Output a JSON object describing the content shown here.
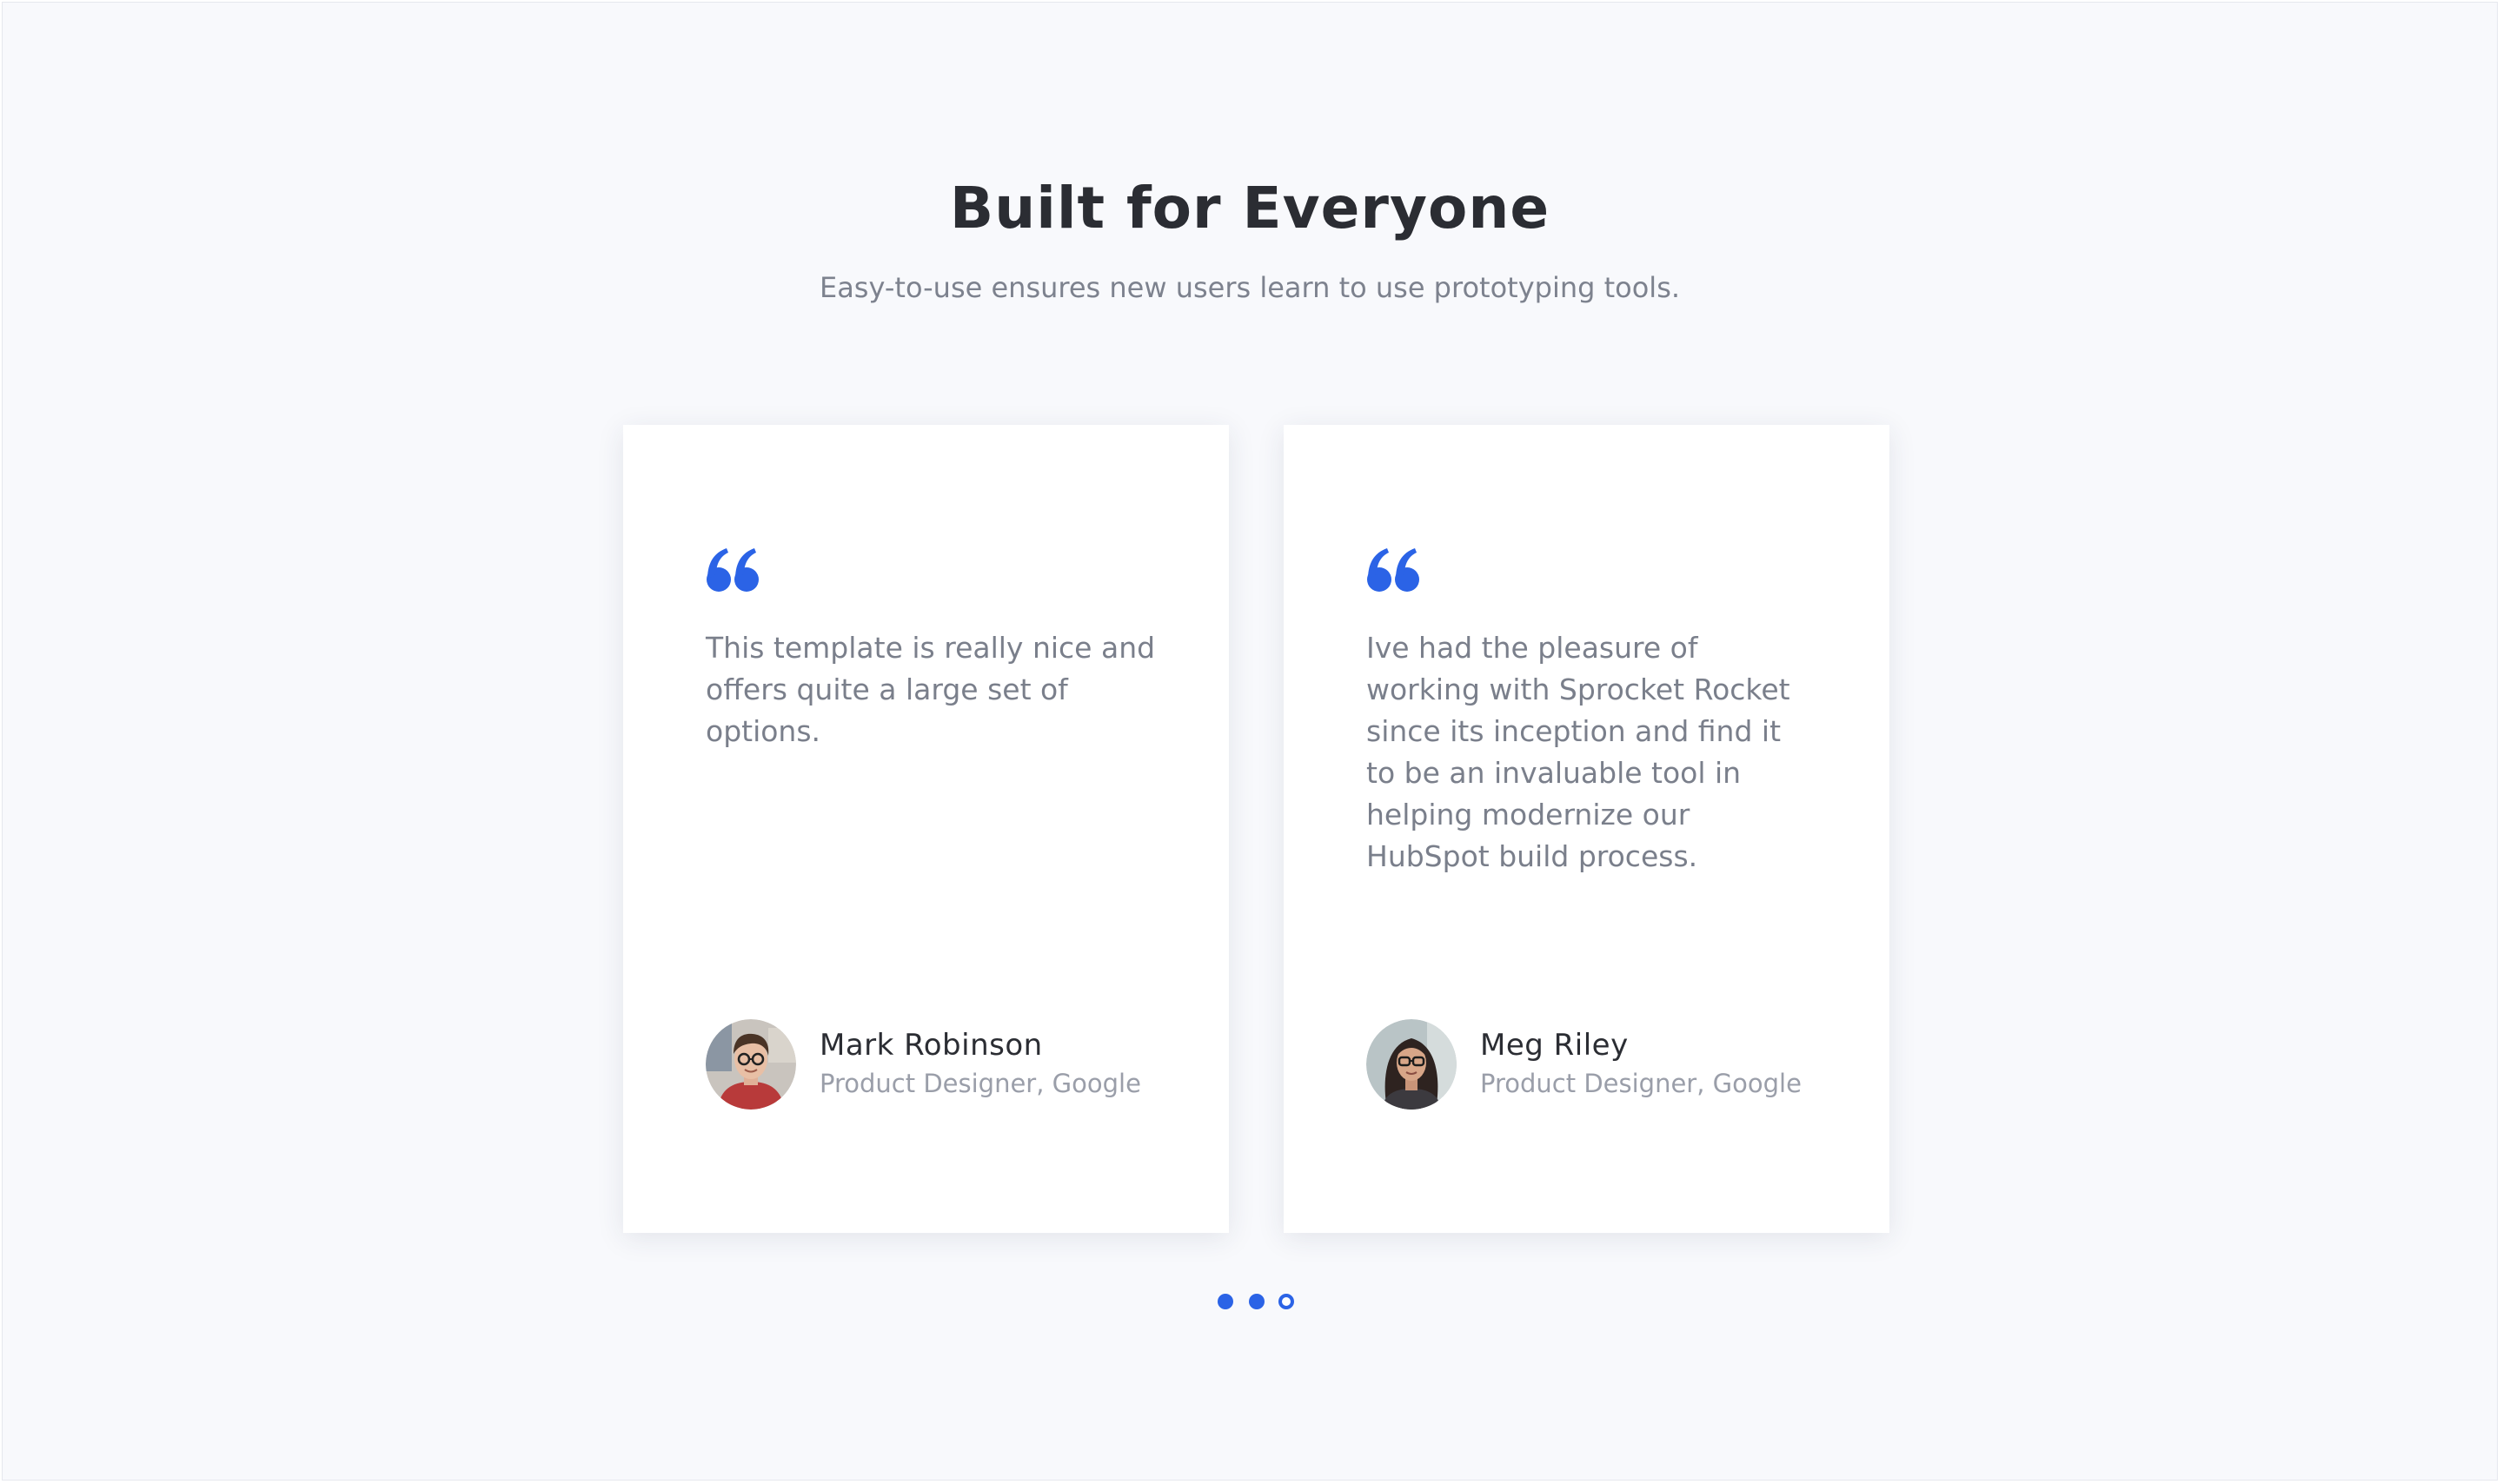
{
  "section": {
    "title": "Built for Everyone",
    "subtitle": "Easy-to-use ensures new users learn to use prototyping tools."
  },
  "colors": {
    "accent": "#2b63e6",
    "heading": "#2b2d33",
    "body_text": "#7a7f8b",
    "muted": "#9a9ea9",
    "background": "#f8f9fc",
    "card": "#ffffff"
  },
  "testimonials": [
    {
      "quote_icon": "quote-icon",
      "quote": "This template is really nice and offers quite a large set of options.",
      "name": "Mark Robinson",
      "role": "Product Designer, Google",
      "avatar": "avatar-man-glasses"
    },
    {
      "quote_icon": "quote-icon",
      "quote": "Ive had the pleasure of working with Sprocket Rocket since its inception and find it to be an invaluable tool in helping modernize our HubSpot build process.",
      "name": "Meg Riley",
      "role": "Product Designer, Google",
      "avatar": "avatar-woman-glasses"
    }
  ],
  "pagination": {
    "total": 3,
    "active_index": 2
  }
}
